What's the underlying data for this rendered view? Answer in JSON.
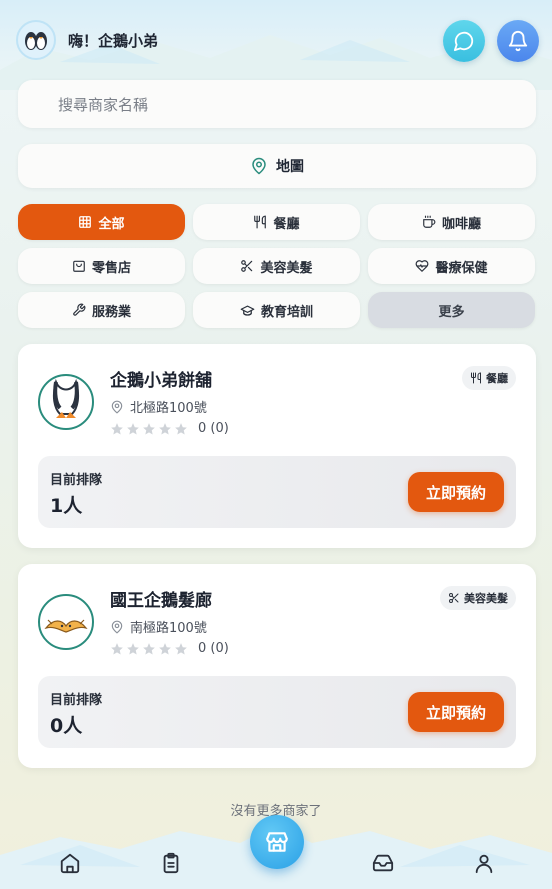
{
  "header": {
    "greeting": "嗨！企鵝小弟",
    "avatar_icon": "penguin-avatar",
    "chat_icon": "chat-bubble-icon",
    "bell_icon": "bell-icon"
  },
  "search": {
    "placeholder": "搜尋商家名稱"
  },
  "map_button": {
    "label": "地圖",
    "icon": "map-pin-icon"
  },
  "categories": [
    {
      "label": "全部",
      "icon": "grid-icon",
      "active": true
    },
    {
      "label": "餐廳",
      "icon": "fork-knife-icon"
    },
    {
      "label": "咖啡廳",
      "icon": "coffee-cup-icon"
    },
    {
      "label": "零售店",
      "icon": "shopping-bag-icon"
    },
    {
      "label": "美容美髮",
      "icon": "scissors-icon"
    },
    {
      "label": "醫療保健",
      "icon": "heart-pulse-icon"
    },
    {
      "label": "服務業",
      "icon": "wrench-icon"
    },
    {
      "label": "教育培訓",
      "icon": "graduation-cap-icon"
    },
    {
      "label": "更多",
      "icon": ""
    }
  ],
  "shops": [
    {
      "name": "企鵝小弟餅舖",
      "address": "北極路100號",
      "rating_text": "0 (0)",
      "tag": "餐廳",
      "tag_icon": "fork-knife-icon",
      "queue_label": "目前排隊",
      "queue_count": "1人",
      "book_label": "立即預約"
    },
    {
      "name": "國王企鵝髮廊",
      "address": "南極路100號",
      "rating_text": "0 (0)",
      "tag": "美容美髮",
      "tag_icon": "scissors-icon",
      "queue_label": "目前排隊",
      "queue_count": "0人",
      "book_label": "立即預約"
    }
  ],
  "footer_note": "沒有更多商家了",
  "bottom_nav": {
    "items": [
      "home-icon",
      "clipboard-icon",
      "store-icon",
      "inbox-icon",
      "user-icon"
    ]
  },
  "colors": {
    "accent": "#e3580f",
    "chat": "#39bfe0",
    "bell": "#4b86ec",
    "logo_ring": "#2a8c7d"
  }
}
